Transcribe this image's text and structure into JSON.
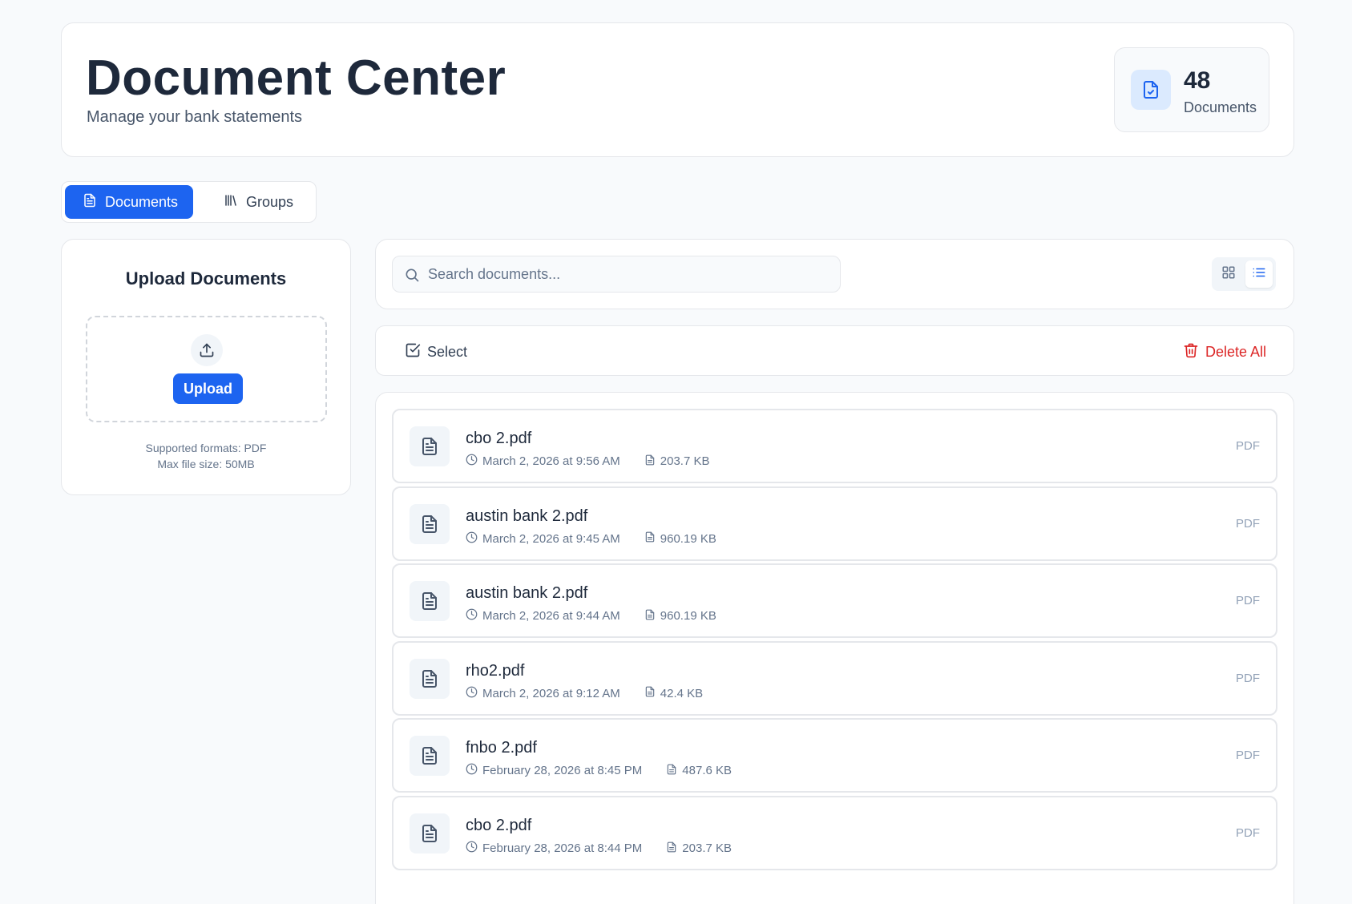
{
  "header": {
    "title": "Document Center",
    "subtitle": "Manage your bank statements",
    "count_value": "48",
    "count_label": "Documents"
  },
  "tabs": [
    {
      "label": "Documents",
      "icon": "document-icon",
      "active": true
    },
    {
      "label": "Groups",
      "icon": "library-icon",
      "active": false
    }
  ],
  "upload": {
    "title": "Upload Documents",
    "button_label": "Upload",
    "formats_note": "Supported formats: PDF",
    "size_note": "Max file size: 50MB"
  },
  "search": {
    "placeholder": "Search documents...",
    "value": ""
  },
  "view_toggle": {
    "options": [
      "grid-icon",
      "list-icon"
    ],
    "selected": "list"
  },
  "actions": {
    "select_label": "Select",
    "delete_all_label": "Delete All"
  },
  "colors": {
    "primary": "#1d64f0",
    "danger": "#dc2626",
    "background": "#f8fafc",
    "text": "#1e293b",
    "muted": "#64748b"
  },
  "documents": [
    {
      "name": "cbo 2.pdf",
      "date": "March 2, 2026 at 9:56 AM",
      "size": "203.7 KB",
      "type": "PDF"
    },
    {
      "name": "austin bank 2.pdf",
      "date": "March 2, 2026 at 9:45 AM",
      "size": "960.19 KB",
      "type": "PDF"
    },
    {
      "name": "austin bank 2.pdf",
      "date": "March 2, 2026 at 9:44 AM",
      "size": "960.19 KB",
      "type": "PDF"
    },
    {
      "name": "rho2.pdf",
      "date": "March 2, 2026 at 9:12 AM",
      "size": "42.4 KB",
      "type": "PDF"
    },
    {
      "name": "fnbo 2.pdf",
      "date": "February 28, 2026 at 8:45 PM",
      "size": "487.6 KB",
      "type": "PDF"
    },
    {
      "name": "cbo 2.pdf",
      "date": "February 28, 2026 at 8:44 PM",
      "size": "203.7 KB",
      "type": "PDF"
    }
  ]
}
